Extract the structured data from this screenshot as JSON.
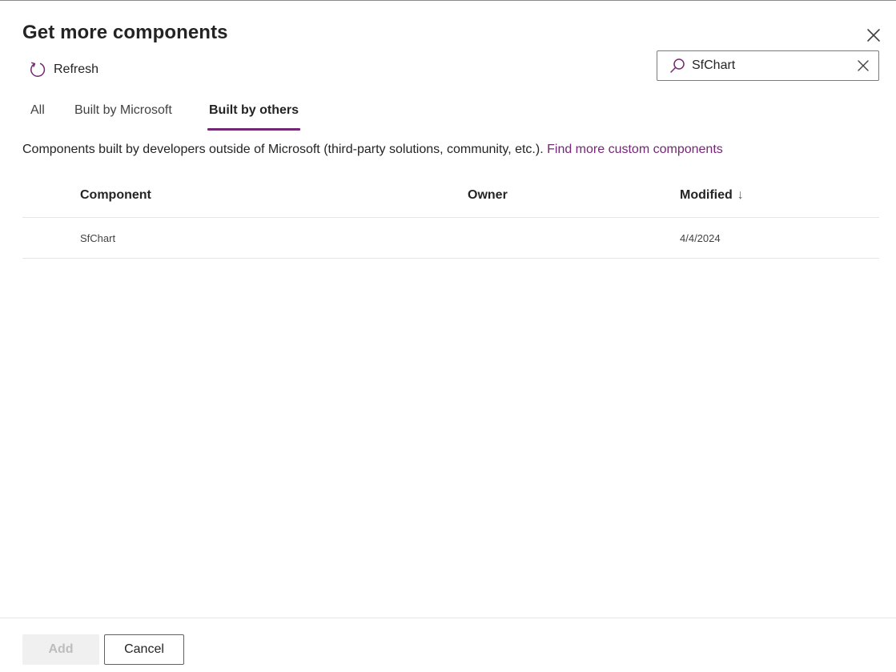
{
  "dialog": {
    "title": "Get more components",
    "refresh_label": "Refresh",
    "search": {
      "value": "SfChart",
      "placeholder": "Search"
    },
    "tabs": [
      {
        "label": "All",
        "active": false
      },
      {
        "label": "Built by Microsoft",
        "active": false
      },
      {
        "label": "Built by others",
        "active": true
      }
    ],
    "description": "Components built by developers outside of Microsoft (third-party solutions, community, etc.).",
    "description_link": "Find more custom components",
    "table": {
      "columns": {
        "component": "Component",
        "owner": "Owner",
        "modified": "Modified",
        "sort_indicator": "↓"
      },
      "rows": [
        {
          "component": "SfChart",
          "owner": "",
          "modified": "4/4/2024"
        }
      ]
    },
    "footer": {
      "add_label": "Add",
      "cancel_label": "Cancel"
    },
    "colors": {
      "accent": "#742774",
      "text": "#242424",
      "divider": "#e6e6e6"
    }
  }
}
